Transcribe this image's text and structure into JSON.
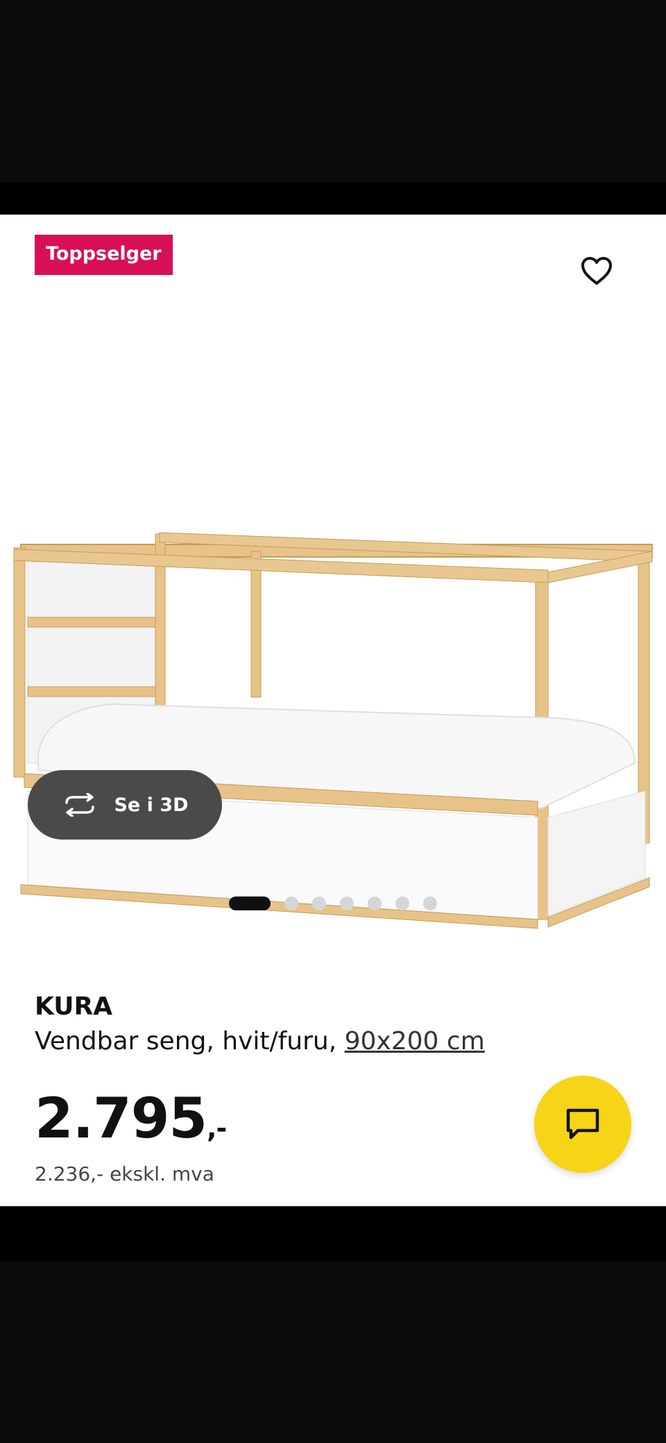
{
  "badge": {
    "label": "Toppselger",
    "color": "#d80f55"
  },
  "icons": {
    "favorite": "heart-outline-icon",
    "rotate": "rotate-3d-icon",
    "chat": "chat-bubble-icon"
  },
  "view3d": {
    "label": "Se i 3D"
  },
  "carousel": {
    "total": 7,
    "active_index": 0
  },
  "product": {
    "brand": "KURA",
    "description_prefix": "Vendbar seng, hvit/furu, ",
    "size_link": "90x200 cm",
    "price_main": "2.795",
    "price_suffix": ",-",
    "price_ex_vat": "2.236,- ekskl. mva"
  },
  "colors": {
    "accent_yellow": "#f7d417",
    "button_dark": "#4a4a4a"
  }
}
